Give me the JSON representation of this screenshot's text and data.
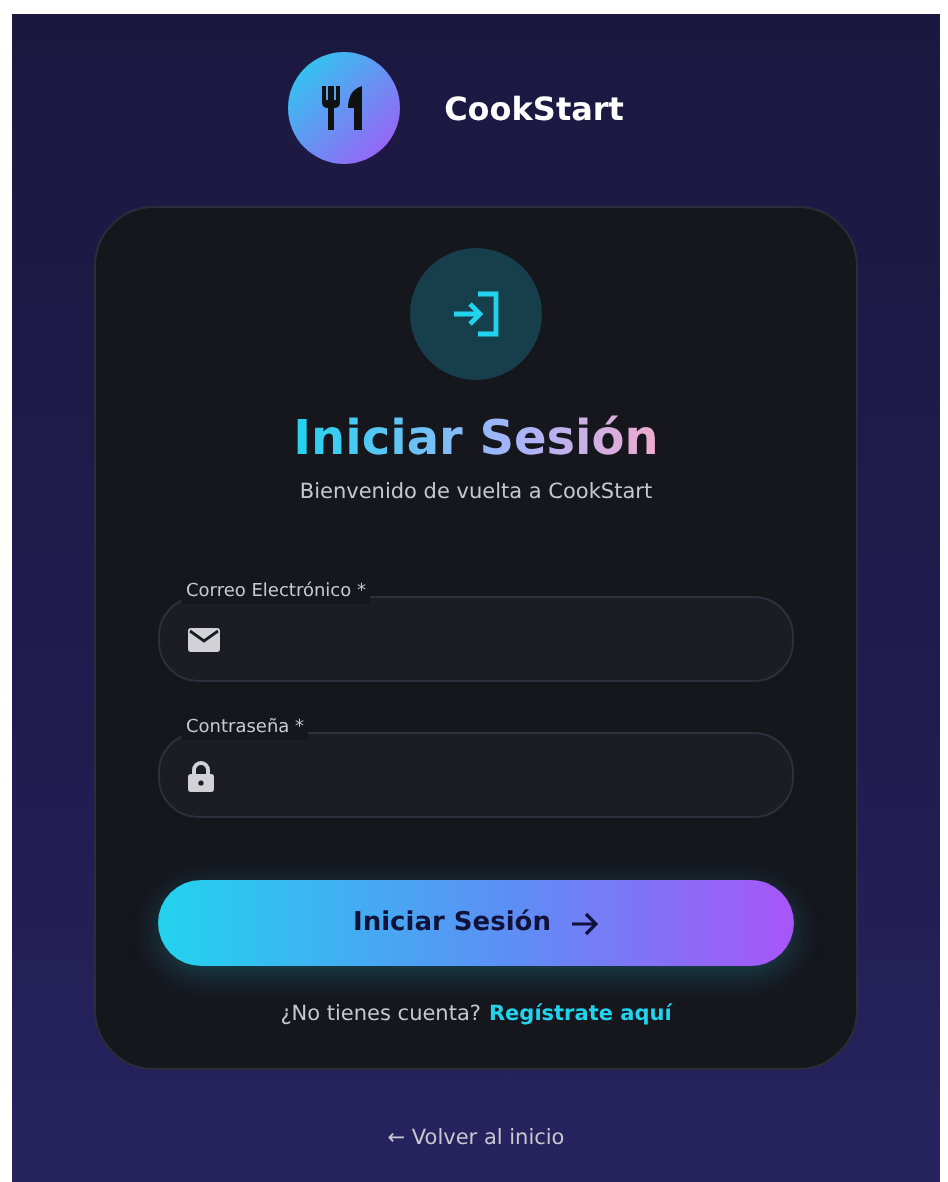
{
  "brand": {
    "name": "CookStart"
  },
  "card": {
    "title": "Iniciar Sesión",
    "subtitle": "Bienvenido de vuelta a CookStart",
    "fields": [
      {
        "kind": "email",
        "label": "Correo Electrónico *"
      },
      {
        "kind": "password",
        "label": "Contraseña *"
      }
    ],
    "submit": "Iniciar Sesión",
    "signup_prompt": "¿No tienes cuenta?",
    "signup_link": "Regístrate aquí"
  },
  "back_link": "← Volver al inicio"
}
